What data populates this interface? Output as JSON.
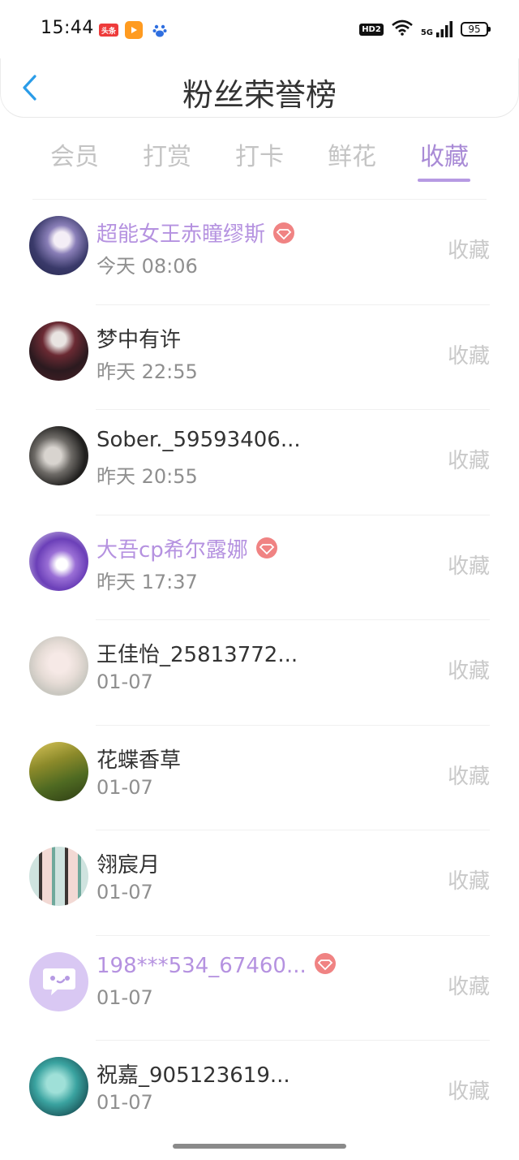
{
  "status_bar": {
    "time": "15:44",
    "app_icons": [
      "toutiao-icon",
      "video-app-icon",
      "baidu-icon"
    ],
    "toutiao_label": "头条",
    "hd_label": "HD2",
    "network": "5G",
    "battery": "95"
  },
  "header": {
    "title": "粉丝荣誉榜",
    "back_icon": "chevron-left-icon"
  },
  "tabs": [
    {
      "label": "会员",
      "active": false
    },
    {
      "label": "打赏",
      "active": false
    },
    {
      "label": "打卡",
      "active": false
    },
    {
      "label": "鲜花",
      "active": false
    },
    {
      "label": "收藏",
      "active": true
    }
  ],
  "colors": {
    "accent": "#b69ae3",
    "vip_name": "#b592e0",
    "vip_badge": "#f08383",
    "muted": "#c9c9c9"
  },
  "fans": [
    {
      "name": "超能女王赤瞳缪斯",
      "time": "今天 08:06",
      "action": "收藏",
      "vip": true,
      "avatar": "avatar-anime-girl"
    },
    {
      "name": "梦中有许",
      "time": "昨天 22:55",
      "action": "收藏",
      "vip": false,
      "avatar": "avatar-dark-character"
    },
    {
      "name": "Sober._59593406...",
      "time": "昨天 20:55",
      "action": "收藏",
      "vip": false,
      "avatar": "avatar-dark-photo"
    },
    {
      "name": "大吾cp希尔露娜",
      "time": "昨天 17:37",
      "action": "收藏",
      "vip": true,
      "avatar": "avatar-purple-creature"
    },
    {
      "name": "王佳怡_25813772...",
      "time": "01-07",
      "action": "收藏",
      "vip": false,
      "avatar": "avatar-white-hair"
    },
    {
      "name": "花蝶香草",
      "time": "01-07",
      "action": "收藏",
      "vip": false,
      "avatar": "avatar-forest"
    },
    {
      "name": "翎宸月",
      "time": "01-07",
      "action": "收藏",
      "vip": false,
      "avatar": "avatar-collage"
    },
    {
      "name": "198***534_67460...",
      "time": "01-07",
      "action": "收藏",
      "vip": true,
      "avatar": "avatar-chat-bubble"
    },
    {
      "name": "祝嘉_905123619...",
      "time": "01-07",
      "action": "收藏",
      "vip": false,
      "avatar": "avatar-teal-photo"
    }
  ]
}
